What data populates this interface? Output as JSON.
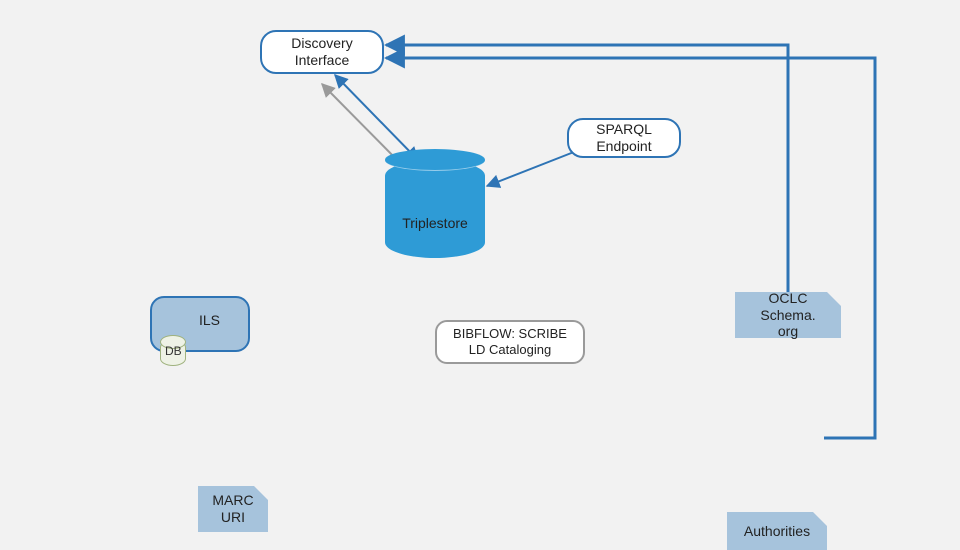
{
  "nodes": {
    "discovery": "Discovery\nInterface",
    "sparql": "SPARQL\nEndpoint",
    "triplestore": "Triplestore",
    "ils": "ILS",
    "db": "DB",
    "bibflow": "BIBFLOW: SCRIBE\nLD Cataloging",
    "oclc": "OCLC\nSchema. org",
    "marc": "MARC\nURI",
    "authorities": "Authorities"
  }
}
